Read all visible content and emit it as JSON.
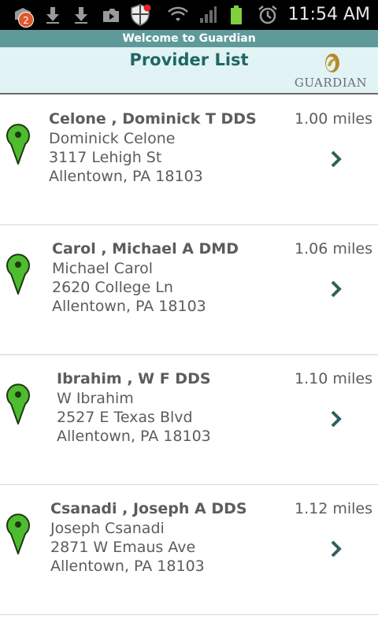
{
  "status_bar": {
    "notification_count": "2",
    "time": "11:54 AM",
    "icons": [
      "notification-icon",
      "download-icon",
      "download-icon",
      "media-icon",
      "security-shield-icon",
      "wifi-icon",
      "signal-icon",
      "battery-icon",
      "alarm-icon"
    ]
  },
  "header": {
    "welcome": "Welcome to Guardian",
    "title": "Provider List",
    "logo_text": "GUARDIAN"
  },
  "colors": {
    "header_bg": "#e1f3f4",
    "welcome_bg": "#5e9a9a",
    "title": "#1f6666",
    "pin": "#4fbb2f",
    "text": "#5c5c5c"
  },
  "providers": [
    {
      "name": "Celone , Dominick T DDS",
      "contact": "Dominick Celone",
      "street": "3117 Lehigh St",
      "city": "Allentown, PA 18103",
      "distance": "1.00 miles"
    },
    {
      "name": "Carol , Michael A DMD",
      "contact": "Michael Carol",
      "street": "2620 College Ln",
      "city": "Allentown, PA 18103",
      "distance": "1.06 miles"
    },
    {
      "name": "Ibrahim , W F DDS",
      "contact": "W Ibrahim",
      "street": "2527 E Texas Blvd",
      "city": "Allentown, PA 18103",
      "distance": "1.10 miles"
    },
    {
      "name": "Csanadi , Joseph A DDS",
      "contact": "Joseph Csanadi",
      "street": "2871 W Emaus Ave",
      "city": "Allentown, PA 18103",
      "distance": "1.12 miles"
    }
  ]
}
